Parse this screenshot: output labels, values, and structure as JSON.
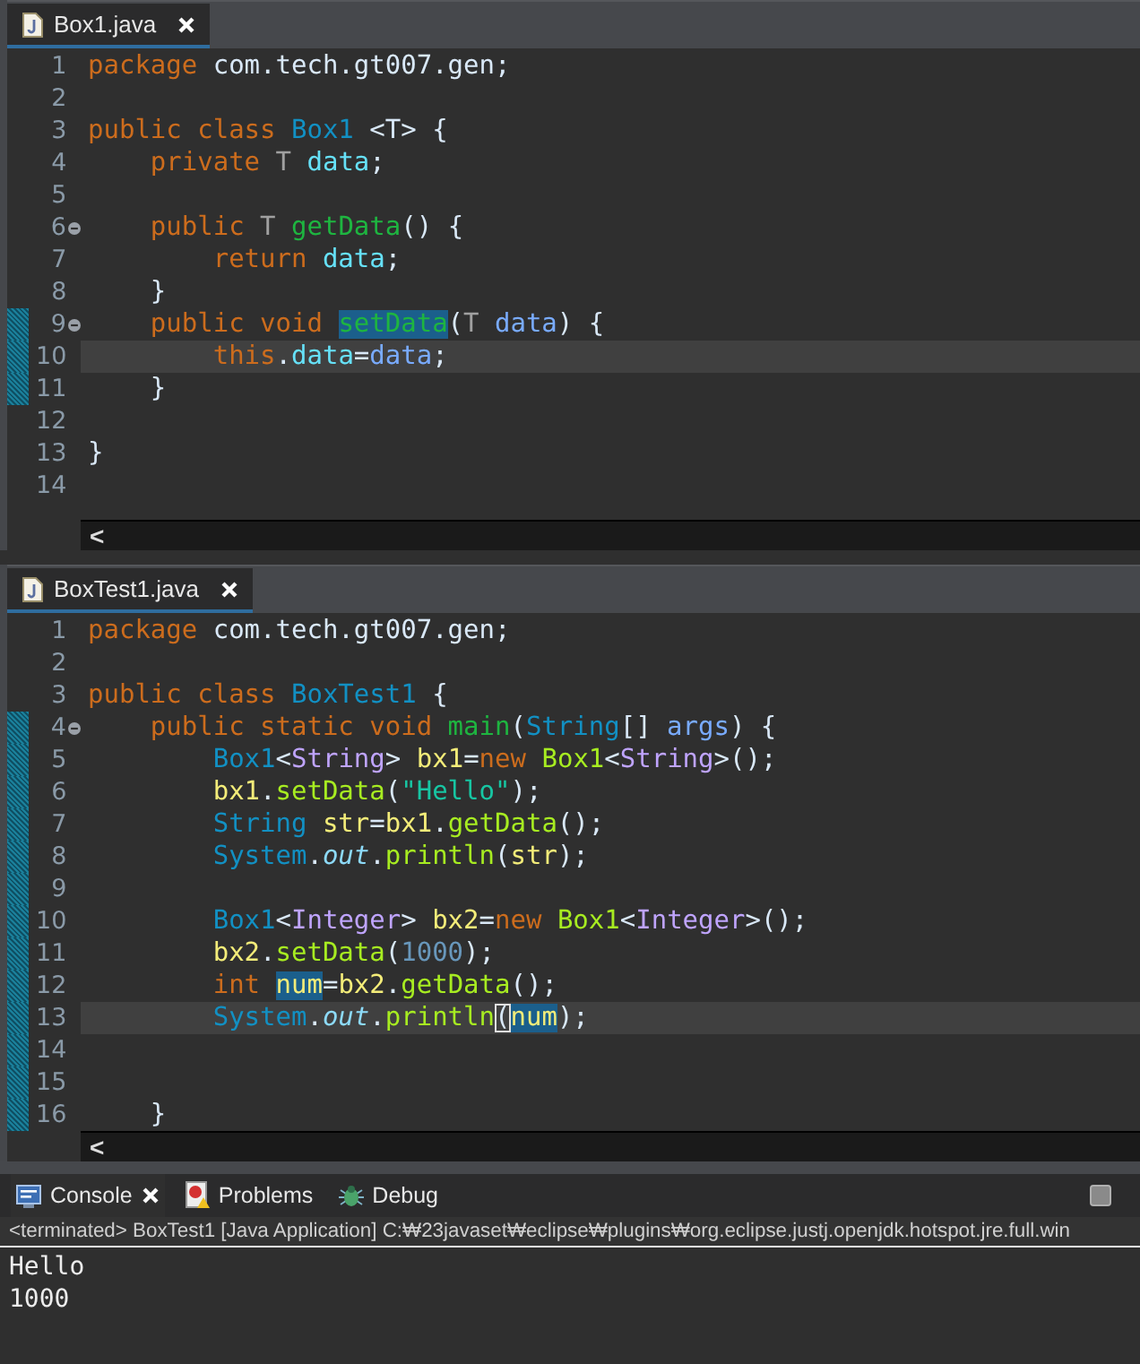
{
  "editors": [
    {
      "tab": {
        "label": "Box1.java",
        "selected": true
      },
      "lines": [
        {
          "number": "1",
          "fold": false,
          "changed": false,
          "current": false,
          "tokens": [
            {
              "text": "package",
              "kind": "keyword",
              "highlighted": false
            },
            {
              "text": " com.tech.gt007.gen;",
              "kind": "plain",
              "highlighted": false
            }
          ]
        },
        {
          "number": "2",
          "fold": false,
          "changed": false,
          "current": false
        },
        {
          "number": "3",
          "fold": false,
          "changed": false,
          "current": false,
          "tokens": [
            {
              "text": "public class",
              "kind": "keyword",
              "highlighted": false
            },
            {
              "text": " Box1",
              "kind": "type",
              "highlighted": false
            },
            {
              "text": " <T> {",
              "kind": "plain",
              "highlighted": false
            }
          ]
        },
        {
          "number": "4",
          "fold": false,
          "changed": false,
          "current": false,
          "tokens": [
            {
              "text": "    private",
              "kind": "keyword",
              "highlighted": false
            },
            {
              "text": " T",
              "kind": "type_var",
              "highlighted": false
            },
            {
              "text": " data",
              "kind": "field",
              "highlighted": false
            },
            {
              "text": ";",
              "kind": "plain",
              "highlighted": false
            }
          ]
        },
        {
          "number": "5",
          "fold": false,
          "changed": false,
          "current": false
        },
        {
          "number": "6",
          "fold": true,
          "changed": false,
          "current": false,
          "tokens": [
            {
              "text": "    public",
              "kind": "keyword",
              "highlighted": false
            },
            {
              "text": " T ",
              "kind": "type_var",
              "highlighted": false
            },
            {
              "text": "getData",
              "kind": "method_decl",
              "highlighted": false
            },
            {
              "text": "() {",
              "kind": "plain",
              "highlighted": false
            }
          ]
        },
        {
          "number": "7",
          "fold": false,
          "changed": false,
          "current": false,
          "tokens": [
            {
              "text": "        return",
              "kind": "keyword",
              "highlighted": false
            },
            {
              "text": " data",
              "kind": "field",
              "highlighted": false
            },
            {
              "text": ";",
              "kind": "plain",
              "highlighted": false
            }
          ]
        },
        {
          "number": "8",
          "fold": false,
          "changed": false,
          "current": false,
          "tokens": [
            {
              "text": "    }",
              "kind": "plain",
              "highlighted": false
            }
          ]
        },
        {
          "number": "9",
          "fold": true,
          "changed": true,
          "current": false,
          "tokens": [
            {
              "text": "    public void ",
              "kind": "keyword",
              "highlighted": false
            },
            {
              "text": "setData",
              "kind": "method_decl",
              "highlighted": true
            },
            {
              "text": "(",
              "kind": "plain",
              "highlighted": false
            },
            {
              "text": "T",
              "kind": "type_var",
              "highlighted": false
            },
            {
              "text": " data",
              "kind": "param",
              "highlighted": false
            },
            {
              "text": ") {",
              "kind": "plain",
              "highlighted": false
            }
          ]
        },
        {
          "number": "10",
          "fold": false,
          "changed": true,
          "current": true,
          "tokens": [
            {
              "text": "        this",
              "kind": "keyword",
              "highlighted": false
            },
            {
              "text": ".",
              "kind": "plain",
              "highlighted": false
            },
            {
              "text": "data",
              "kind": "field",
              "highlighted": false
            },
            {
              "text": "=",
              "kind": "plain",
              "highlighted": false
            },
            {
              "text": "data",
              "kind": "param",
              "highlighted": false
            },
            {
              "text": ";",
              "kind": "plain",
              "highlighted": false
            }
          ]
        },
        {
          "number": "11",
          "fold": false,
          "changed": true,
          "current": false,
          "tokens": [
            {
              "text": "    }",
              "kind": "plain",
              "highlighted": false
            }
          ]
        },
        {
          "number": "12",
          "fold": false,
          "changed": false,
          "current": false
        },
        {
          "number": "13",
          "fold": false,
          "changed": false,
          "current": false,
          "tokens": [
            {
              "text": "}",
              "kind": "plain",
              "highlighted": false
            }
          ]
        },
        {
          "number": "14",
          "fold": false,
          "changed": false,
          "current": false
        }
      ],
      "scroll_arrow": "<"
    },
    {
      "tab": {
        "label": "BoxTest1.java",
        "selected": true
      },
      "lines": [
        {
          "number": "1",
          "fold": false,
          "changed": false,
          "current": false,
          "tokens": [
            {
              "text": "package",
              "kind": "keyword",
              "highlighted": false
            },
            {
              "text": " com.tech.gt007.gen;",
              "kind": "plain",
              "highlighted": false
            }
          ]
        },
        {
          "number": "2",
          "fold": false,
          "changed": false,
          "current": false
        },
        {
          "number": "3",
          "fold": false,
          "changed": false,
          "current": false,
          "tokens": [
            {
              "text": "public class",
              "kind": "keyword",
              "highlighted": false
            },
            {
              "text": " BoxTest1",
              "kind": "type",
              "highlighted": false
            },
            {
              "text": " {",
              "kind": "plain",
              "highlighted": false
            }
          ]
        },
        {
          "number": "4",
          "fold": true,
          "changed": true,
          "current": false,
          "tokens": [
            {
              "text": "    public static void ",
              "kind": "keyword",
              "highlighted": false
            },
            {
              "text": "main",
              "kind": "method_decl",
              "highlighted": false
            },
            {
              "text": "(",
              "kind": "plain",
              "highlighted": false
            },
            {
              "text": "String",
              "kind": "type",
              "highlighted": false
            },
            {
              "text": "[] ",
              "kind": "plain",
              "highlighted": false
            },
            {
              "text": "args",
              "kind": "param",
              "highlighted": false
            },
            {
              "text": ") {",
              "kind": "plain",
              "highlighted": false
            }
          ]
        },
        {
          "number": "5",
          "fold": false,
          "changed": true,
          "current": false,
          "tokens": [
            {
              "text": "        Box1",
              "kind": "type",
              "highlighted": false
            },
            {
              "text": "<",
              "kind": "plain",
              "highlighted": false
            },
            {
              "text": "String",
              "kind": "type_arg",
              "highlighted": false
            },
            {
              "text": "> ",
              "kind": "plain",
              "highlighted": false
            },
            {
              "text": "bx1",
              "kind": "local",
              "highlighted": false
            },
            {
              "text": "=",
              "kind": "plain",
              "highlighted": false
            },
            {
              "text": "new",
              "kind": "keyword",
              "highlighted": false
            },
            {
              "text": " Box1",
              "kind": "method",
              "highlighted": false
            },
            {
              "text": "<",
              "kind": "plain",
              "highlighted": false
            },
            {
              "text": "String",
              "kind": "type_arg",
              "highlighted": false
            },
            {
              "text": ">();",
              "kind": "plain",
              "highlighted": false
            }
          ]
        },
        {
          "number": "6",
          "fold": false,
          "changed": true,
          "current": false,
          "tokens": [
            {
              "text": "        bx1",
              "kind": "local",
              "highlighted": false
            },
            {
              "text": ".",
              "kind": "plain",
              "highlighted": false
            },
            {
              "text": "setData",
              "kind": "method",
              "highlighted": false
            },
            {
              "text": "(",
              "kind": "plain",
              "highlighted": false
            },
            {
              "text": "\"Hello\"",
              "kind": "string",
              "highlighted": false
            },
            {
              "text": ");",
              "kind": "plain",
              "highlighted": false
            }
          ]
        },
        {
          "number": "7",
          "fold": false,
          "changed": true,
          "current": false,
          "tokens": [
            {
              "text": "        String",
              "kind": "type",
              "highlighted": false
            },
            {
              "text": " str",
              "kind": "local",
              "highlighted": false
            },
            {
              "text": "=",
              "kind": "plain",
              "highlighted": false
            },
            {
              "text": "bx1",
              "kind": "local",
              "highlighted": false
            },
            {
              "text": ".",
              "kind": "plain",
              "highlighted": false
            },
            {
              "text": "getData",
              "kind": "method",
              "highlighted": false
            },
            {
              "text": "();",
              "kind": "plain",
              "highlighted": false
            }
          ]
        },
        {
          "number": "8",
          "fold": false,
          "changed": true,
          "current": false,
          "tokens": [
            {
              "text": "        System",
              "kind": "type",
              "highlighted": false
            },
            {
              "text": ".",
              "kind": "plain",
              "highlighted": false
            },
            {
              "text": "out",
              "kind": "static_field",
              "highlighted": false
            },
            {
              "text": ".",
              "kind": "plain",
              "highlighted": false
            },
            {
              "text": "println",
              "kind": "method",
              "highlighted": false
            },
            {
              "text": "(",
              "kind": "plain",
              "highlighted": false
            },
            {
              "text": "str",
              "kind": "local",
              "highlighted": false
            },
            {
              "text": ");",
              "kind": "plain",
              "highlighted": false
            }
          ]
        },
        {
          "number": "9",
          "fold": false,
          "changed": true,
          "current": false
        },
        {
          "number": "10",
          "fold": false,
          "changed": true,
          "current": false,
          "tokens": [
            {
              "text": "        Box1",
              "kind": "type",
              "highlighted": false
            },
            {
              "text": "<",
              "kind": "plain",
              "highlighted": false
            },
            {
              "text": "Integer",
              "kind": "type_arg",
              "highlighted": false
            },
            {
              "text": "> ",
              "kind": "plain",
              "highlighted": false
            },
            {
              "text": "bx2",
              "kind": "local",
              "highlighted": false
            },
            {
              "text": "=",
              "kind": "plain",
              "highlighted": false
            },
            {
              "text": "new",
              "kind": "keyword",
              "highlighted": false
            },
            {
              "text": " Box1",
              "kind": "method",
              "highlighted": false
            },
            {
              "text": "<",
              "kind": "plain",
              "highlighted": false
            },
            {
              "text": "Integer",
              "kind": "type_arg",
              "highlighted": false
            },
            {
              "text": ">();",
              "kind": "plain",
              "highlighted": false
            }
          ]
        },
        {
          "number": "11",
          "fold": false,
          "changed": true,
          "current": false,
          "tokens": [
            {
              "text": "        bx2",
              "kind": "local",
              "highlighted": false
            },
            {
              "text": ".",
              "kind": "plain",
              "highlighted": false
            },
            {
              "text": "setData",
              "kind": "method",
              "highlighted": false
            },
            {
              "text": "(",
              "kind": "plain",
              "highlighted": false
            },
            {
              "text": "1000",
              "kind": "number",
              "highlighted": false
            },
            {
              "text": ");",
              "kind": "plain",
              "highlighted": false
            }
          ]
        },
        {
          "number": "12",
          "fold": false,
          "changed": true,
          "current": false,
          "tokens": [
            {
              "text": "        int ",
              "kind": "keyword",
              "highlighted": false
            },
            {
              "text": "num",
              "kind": "local",
              "highlighted": true
            },
            {
              "text": "=",
              "kind": "plain",
              "highlighted": false
            },
            {
              "text": "bx2",
              "kind": "local",
              "highlighted": false
            },
            {
              "text": ".",
              "kind": "plain",
              "highlighted": false
            },
            {
              "text": "getData",
              "kind": "method",
              "highlighted": false
            },
            {
              "text": "();",
              "kind": "plain",
              "highlighted": false
            }
          ]
        },
        {
          "number": "13",
          "fold": false,
          "changed": true,
          "current": true,
          "tokens": [
            {
              "text": "        System",
              "kind": "type",
              "highlighted": false
            },
            {
              "text": ".",
              "kind": "plain",
              "highlighted": false
            },
            {
              "text": "out",
              "kind": "static_field",
              "highlighted": false
            },
            {
              "text": ".",
              "kind": "plain",
              "highlighted": false
            },
            {
              "text": "println",
              "kind": "method",
              "highlighted": false
            },
            {
              "text": "(",
              "kind": "bracket_match",
              "highlighted": false
            },
            {
              "text": "num",
              "kind": "local",
              "highlighted": true
            },
            {
              "text": ");",
              "kind": "plain",
              "highlighted": false
            }
          ]
        },
        {
          "number": "14",
          "fold": false,
          "changed": true,
          "current": false
        },
        {
          "number": "15",
          "fold": false,
          "changed": true,
          "current": false
        },
        {
          "number": "16",
          "fold": false,
          "changed": true,
          "current": false,
          "tokens": [
            {
              "text": "    }",
              "kind": "plain",
              "highlighted": false
            }
          ]
        }
      ],
      "scroll_arrow": "<"
    }
  ],
  "console": {
    "tabs": [
      {
        "label": "Console",
        "kind": "console",
        "selected": true
      },
      {
        "label": "Problems",
        "kind": "problems",
        "selected": false
      },
      {
        "label": "Debug",
        "kind": "debug",
        "selected": false
      }
    ],
    "status": "<terminated> BoxTest1 [Java Application] C:₩23javaset₩eclipse₩plugins₩org.eclipse.justj.openjdk.hotspot.jre.full.win",
    "output": [
      "Hello",
      "1000"
    ]
  }
}
